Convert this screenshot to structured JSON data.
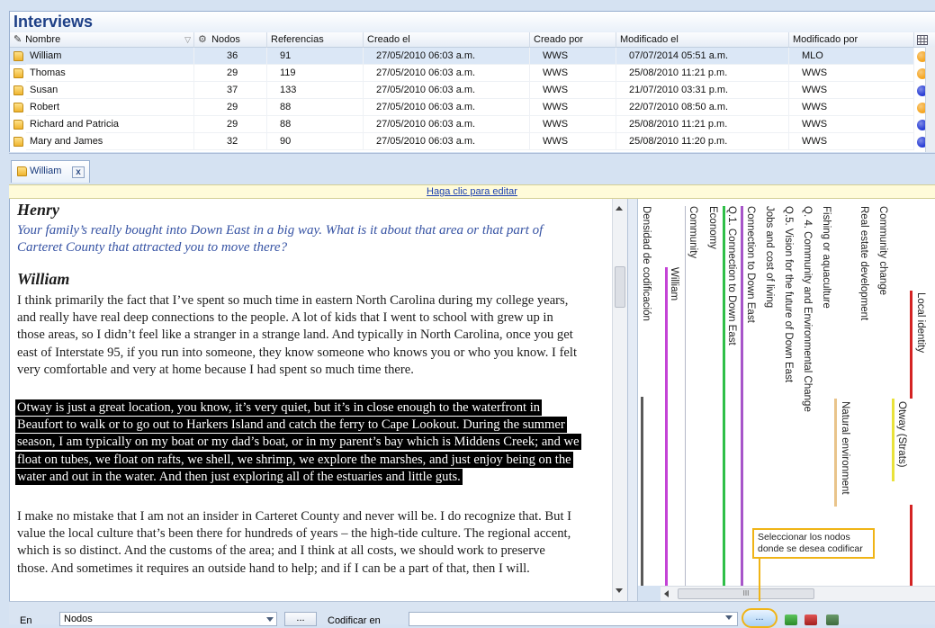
{
  "header": {
    "title": "Interviews"
  },
  "table": {
    "columns": [
      "Nombre",
      "Nodos",
      "Referencias",
      "Creado el",
      "Creado por",
      "Modificado el",
      "Modificado por"
    ],
    "rows": [
      {
        "name": "William",
        "nodes": "36",
        "refs": "91",
        "created": "27/05/2010 06:03 a.m.",
        "created_by": "WWS",
        "modified": "07/07/2014 05:51 a.m.",
        "modified_by": "MLO",
        "dot": "#f5a623"
      },
      {
        "name": "Thomas",
        "nodes": "29",
        "refs": "119",
        "created": "27/05/2010 06:03 a.m.",
        "created_by": "WWS",
        "modified": "25/08/2010 11:21 p.m.",
        "modified_by": "WWS",
        "dot": "#f5a623"
      },
      {
        "name": "Susan",
        "nodes": "37",
        "refs": "133",
        "created": "27/05/2010 06:03 a.m.",
        "created_by": "WWS",
        "modified": "21/07/2010 03:31 p.m.",
        "modified_by": "WWS",
        "dot": "#2a3fd6"
      },
      {
        "name": "Robert",
        "nodes": "29",
        "refs": "88",
        "created": "27/05/2010 06:03 a.m.",
        "created_by": "WWS",
        "modified": "22/07/2010 08:50 a.m.",
        "modified_by": "WWS",
        "dot": "#f5a623"
      },
      {
        "name": "Richard and Patricia",
        "nodes": "29",
        "refs": "88",
        "created": "27/05/2010 06:03 a.m.",
        "created_by": "WWS",
        "modified": "25/08/2010 11:21 p.m.",
        "modified_by": "WWS",
        "dot": "#2a3fd6"
      },
      {
        "name": "Mary and James",
        "nodes": "32",
        "refs": "90",
        "created": "27/05/2010 06:03 a.m.",
        "created_by": "WWS",
        "modified": "25/08/2010 11:20 p.m.",
        "modified_by": "WWS",
        "dot": "#2a3fd6"
      }
    ]
  },
  "tab": {
    "label": "William",
    "close": "x"
  },
  "editbar": {
    "link": "Haga clic para editar"
  },
  "document": {
    "speaker1": "Henry",
    "question": "Your family’s really bought into Down East in a big way. What is it about that area or that part of Carteret County that attracted you to move there?",
    "speaker2": "William",
    "para1": "I think primarily the fact that I’ve spent so much time in eastern North Carolina during my college years, and really have real deep connections to the people. A lot of kids that I went to school with grew up in those areas, so I didn’t feel like a stranger in a strange land. And typically in North Carolina, once you get east of Interstate 95, if you run into someone, they know someone who knows you or who you know. I felt very comfortable and very at home because I had spent so much time there.",
    "para2": "Otway is just a great location, you know, it’s very quiet, but it’s in close enough to the waterfront in Beaufort to walk or to go out to Harkers Island and catch the ferry to Cape Lookout.  During the summer season, I am typically on my boat or my dad’s boat, or in my parent’s bay which is Middens Creek; and we float on tubes, we float on rafts, we shell, we shrimp, we explore the marshes, and just enjoy being on the water and out in the water. And then just exploring all of the estuaries and little guts.",
    "para3": "I make no mistake that I am not an insider in Carteret County and never will be. I do recognize that. But I value the local culture that’s been there for hundreds of years – the high-tide culture. The regional accent, which is so distinct. And the customs of the area; and I think at all costs, we should work to preserve those. And sometimes it requires an outside hand to help; and if I can be a part of that, then I will."
  },
  "stripes": {
    "labels": [
      "Densidad de codificación",
      "William",
      "Community",
      "Economy",
      "Q.1. Connection to Down East",
      "Connection to Down East",
      "Jobs and cost of living",
      "Q.5. Vision for the future of Down East",
      "Q. 4. Community and Environmental Change",
      "Fishing or aquaculture",
      "Natural environment",
      "Real estate development",
      "Community change",
      "Otway (Strats)",
      "Local identity"
    ],
    "colors": {
      "william": "#c443d6",
      "economy": "#2fbf48",
      "connection": "#a755c9",
      "natural": "#e9c48b",
      "otway": "#e9e23a",
      "local": "#d42323",
      "density": "#5a5a5a"
    },
    "scroll_thumb": "III"
  },
  "callout": {
    "text": "Seleccionar los nodos donde se desea codificar"
  },
  "bottombar": {
    "en_label": "En",
    "nodes_select": "Nodos",
    "dots": "...",
    "codificar_label": "Codificar en",
    "select_button": "..."
  }
}
